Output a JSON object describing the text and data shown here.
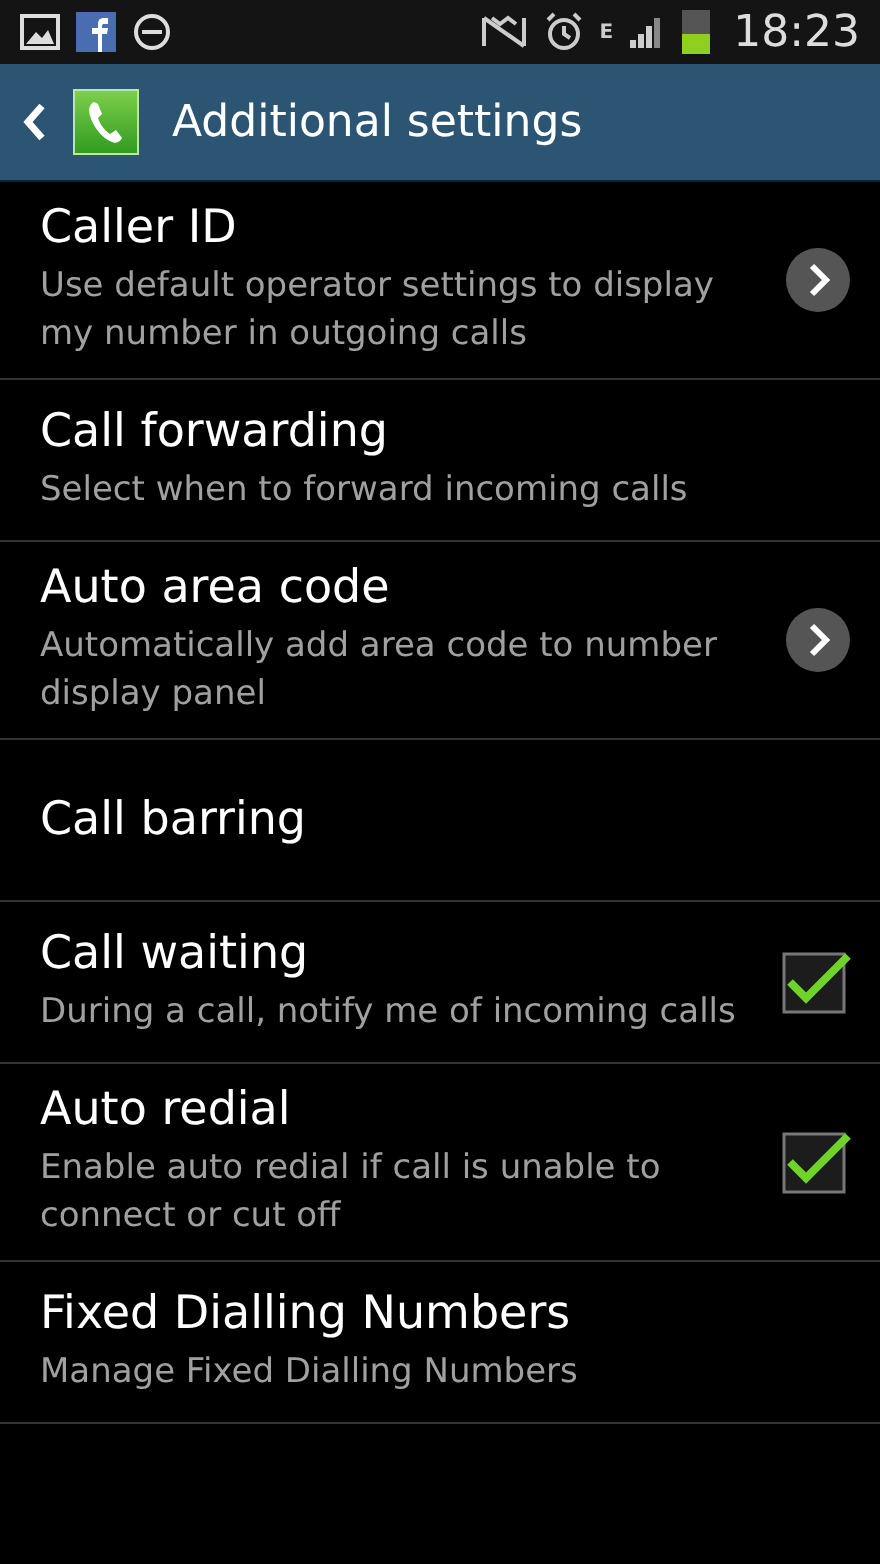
{
  "status_bar": {
    "network_type": "E",
    "time": "18:23"
  },
  "action_bar": {
    "title": "Additional settings"
  },
  "settings": [
    {
      "kind": "chevron",
      "title": "Caller ID",
      "summary": "Use default operator settings to display my number in outgoing calls"
    },
    {
      "kind": "plain",
      "title": "Call forwarding",
      "summary": "Select when to forward incoming calls"
    },
    {
      "kind": "chevron",
      "title": "Auto area code",
      "summary": "Automatically add area code to number display panel"
    },
    {
      "kind": "plain",
      "title": "Call barring"
    },
    {
      "kind": "checkbox",
      "title": "Call waiting",
      "summary": "During a call, notify me of incoming calls",
      "checked": true
    },
    {
      "kind": "checkbox",
      "title": "Auto redial",
      "summary": "Enable auto redial if call is unable to connect or cut off",
      "checked": true
    },
    {
      "kind": "plain",
      "title": "Fixed Dialling Numbers",
      "summary": "Manage Fixed Dialling Numbers"
    }
  ]
}
